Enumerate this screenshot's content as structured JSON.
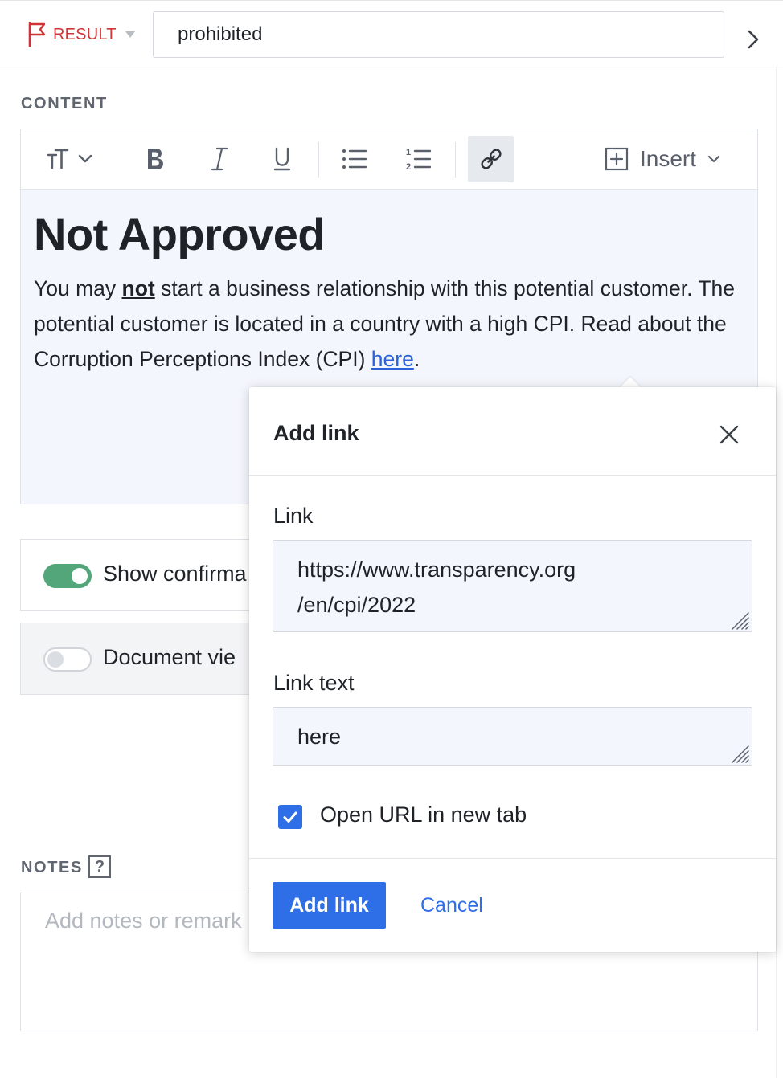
{
  "topbar": {
    "result_label": "RESULT",
    "result_value": "prohibited",
    "result_color": "#d13438"
  },
  "content_section": {
    "label": "CONTENT",
    "toolbar": {
      "icons": [
        "text-size-icon",
        "chevron-down-icon",
        "bold-icon",
        "italic-icon",
        "underline-icon",
        "bullet-list-icon",
        "numbered-list-icon",
        "link-icon",
        "plus-square-icon"
      ],
      "insert_label": "Insert"
    },
    "document": {
      "title": "Not Approved",
      "para_part1": "You may ",
      "para_bold": "not",
      "para_part2": " start a business relationship with this potential customer. The potential customer is located in a country with a high CPI. Read about the Corruption Perceptions Index (CPI) ",
      "para_link": "here",
      "para_end": "."
    }
  },
  "toggles": [
    {
      "label": "Show confirma",
      "on": true
    },
    {
      "label": "Document vie",
      "on": false
    }
  ],
  "notes_section": {
    "label": "NOTES",
    "help": "?",
    "placeholder": "Add notes or remark"
  },
  "dialog": {
    "title": "Add link",
    "link_label": "Link",
    "link_value": "https://www.transparency.org\n/en/cpi/2022",
    "link_text_label": "Link text",
    "link_text_value": "here",
    "new_tab_label": "Open URL in new tab",
    "new_tab_checked": true,
    "submit_label": "Add link",
    "cancel_label": "Cancel"
  },
  "colors": {
    "accent": "#2e6ee6",
    "toggle_on": "#52a67a",
    "editor_bg": "#f3f6fc",
    "link": "#2b62d9"
  }
}
